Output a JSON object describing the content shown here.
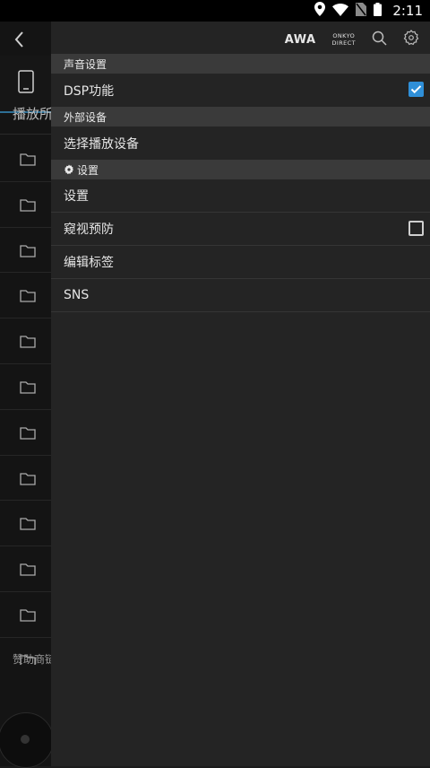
{
  "status_bar": {
    "time": "2:11",
    "icons": [
      "location-icon",
      "wifi-icon",
      "no-sim-icon",
      "battery-icon"
    ]
  },
  "background_page": {
    "back_icon": "chevron-left-icon",
    "device_icon": "phone-icon",
    "player_label": "播放所",
    "folder_icon": "folder-icon",
    "folder_count": 12,
    "sponsor_label": "赞助商链"
  },
  "drawer": {
    "top_icons": {
      "awa": "AWA",
      "onkyo_line1": "ONKYO",
      "onkyo_line2": "DIRECT",
      "search_icon": "search-icon",
      "settings_icon": "settings-gear-icon"
    },
    "sections": [
      {
        "header": "声音设置",
        "items": [
          {
            "label": "DSP功能",
            "checkbox": true,
            "checked": true
          }
        ]
      },
      {
        "header": "外部设备",
        "items": [
          {
            "label": "选择播放设备"
          }
        ]
      },
      {
        "header": "设置",
        "header_icon": "gear-icon",
        "items": [
          {
            "label": "设置"
          },
          {
            "label": "窥视预防",
            "checkbox": true,
            "checked": false
          },
          {
            "label": "编辑标签"
          },
          {
            "label": "SNS"
          }
        ]
      }
    ]
  },
  "colors": {
    "drawer_bg": "#242424",
    "section_bg": "#3a3a3a",
    "accent": "#2f8fd8",
    "statusbar_bg": "#000000"
  }
}
